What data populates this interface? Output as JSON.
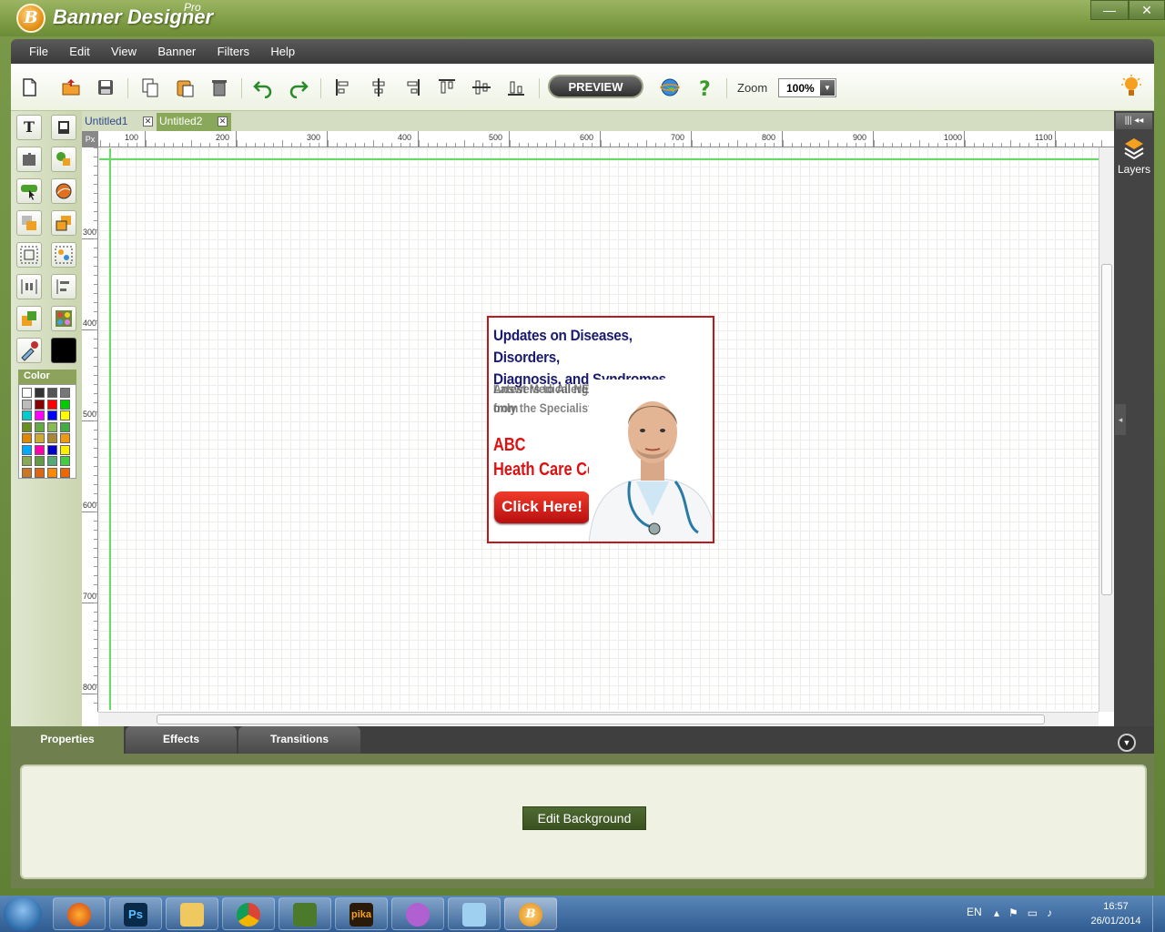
{
  "window": {
    "title": "Banner Designer",
    "edition": "Pro",
    "minimize": "—",
    "close": "✕"
  },
  "menu": [
    "File",
    "Edit",
    "View",
    "Banner",
    "Filters",
    "Help"
  ],
  "toolbar": {
    "preview_label": "PREVIEW",
    "zoom_label": "Zoom",
    "zoom_value": "100%",
    "icons": [
      "new-file-icon",
      "open-icon",
      "save-icon",
      "copy-icon",
      "paste-icon",
      "delete-icon",
      "undo-icon",
      "redo-icon",
      "align-left-icon",
      "align-center-icon",
      "align-right-icon",
      "align-top-icon",
      "align-middle-icon",
      "align-bottom-icon",
      "globe-icon",
      "help-icon",
      "tips-bulb-icon"
    ]
  },
  "tools": {
    "text_glyph": "T",
    "color_label": "Color",
    "palette": [
      "#ffffff",
      "#333333",
      "#555555",
      "#777777",
      "#bbbbbb",
      "#880000",
      "#ff0000",
      "#00cc00",
      "#00cccc",
      "#ff00ff",
      "#0000ff",
      "#ffff00",
      "#6b8e23",
      "#66aa44",
      "#88bb55",
      "#44aa44",
      "#dd8800",
      "#ccaa33",
      "#aa8833",
      "#ee9911",
      "#00aaff",
      "#ff00aa",
      "#0000cc",
      "#ffee00",
      "#88aa55",
      "#669944",
      "#55aa77",
      "#44cc44",
      "#cc7722",
      "#dd6611",
      "#ff8800",
      "#ee6600"
    ],
    "current_color": "#000000"
  },
  "tabs": [
    {
      "label": "Untitled1",
      "active": false
    },
    {
      "label": "Untitled2",
      "active": true
    }
  ],
  "ruler": {
    "unit": "Px",
    "top": [
      "100",
      "200",
      "300",
      "400",
      "500",
      "600",
      "700",
      "800",
      "900",
      "1000",
      "1100"
    ],
    "left": [
      "300",
      "400",
      "500",
      "600",
      "700",
      "800"
    ]
  },
  "banner": {
    "headline_1": "Updates on Diseases, Disorders,",
    "headline_2": "Diagnosis, and Syndromes",
    "sub_ghost_1": "Answers to Allergy Questions",
    "sub_ghost_2": "Latest Medical NEWS",
    "sub_1": "only the Specialists",
    "sub_2": "from",
    "brand_1": "ABC",
    "brand_2": "Heath Care Center",
    "cta": "Click Here!"
  },
  "right_panel": {
    "layers_label": "Layers"
  },
  "bottom": {
    "tabs": [
      "Properties",
      "Effects",
      "Transitions"
    ],
    "edit_background": "Edit Background"
  },
  "taskbar": {
    "apps": [
      "firefox",
      "photoshop",
      "file-explorer",
      "chrome",
      "paint-tool",
      "pika",
      "messenger",
      "notepad",
      "banner-designer"
    ],
    "photoshop_label": "Ps",
    "pika_label": "pika",
    "lang": "EN",
    "time": "16:57",
    "date": "26/01/2014"
  }
}
